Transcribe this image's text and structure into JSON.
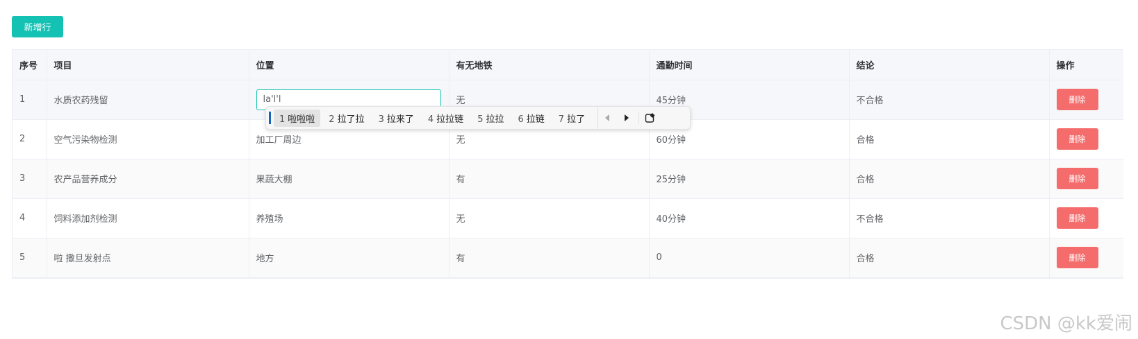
{
  "toolbar": {
    "add_row_label": "新增行"
  },
  "table": {
    "headers": [
      "序号",
      "项目",
      "位置",
      "有无地铁",
      "通勤时间",
      "结论",
      "操作"
    ],
    "delete_label": "删除",
    "rows": [
      {
        "index": "1",
        "item": "水质农药残留",
        "location": "la'l'l",
        "subway": "无",
        "commute": "45分钟",
        "result": "不合格"
      },
      {
        "index": "2",
        "item": "空气污染物检测",
        "location": "加工厂周边",
        "subway": "无",
        "commute": "60分钟",
        "result": "合格"
      },
      {
        "index": "3",
        "item": "农产品营养成分",
        "location": "果蔬大棚",
        "subway": "有",
        "commute": "25分钟",
        "result": "合格"
      },
      {
        "index": "4",
        "item": "饲料添加剂检测",
        "location": "养殖场",
        "subway": "无",
        "commute": "40分钟",
        "result": "不合格"
      },
      {
        "index": "5",
        "item": "啦 撒旦发射点",
        "location": "地方",
        "subway": "有",
        "commute": "0",
        "result": "合格"
      }
    ]
  },
  "ime": {
    "candidates": [
      {
        "num": "1",
        "text": "啦啦啦"
      },
      {
        "num": "2",
        "text": "拉了拉"
      },
      {
        "num": "3",
        "text": "拉来了"
      },
      {
        "num": "4",
        "text": "拉拉链"
      },
      {
        "num": "5",
        "text": "拉拉"
      },
      {
        "num": "6",
        "text": "拉链"
      },
      {
        "num": "7",
        "text": "拉了"
      }
    ]
  },
  "watermark": "CSDN @kk爱闹",
  "colors": {
    "accent": "#13c2b3",
    "danger": "#f56c6c"
  }
}
